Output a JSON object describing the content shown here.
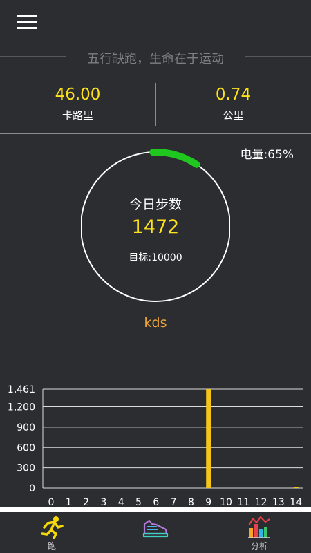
{
  "header": {
    "menu_icon": "hamburger-menu-icon"
  },
  "slogan": "五行缺跑，生命在于运动",
  "stats": {
    "calories": {
      "value": "46.00",
      "label": "卡路里"
    },
    "distance": {
      "value": "0.74",
      "label": "公里"
    }
  },
  "battery": "电量:65%",
  "ring": {
    "title": "今日步数",
    "steps": "1472",
    "goal": "目标:10000",
    "progress": 0.1472,
    "progress_color": "#1fc71f"
  },
  "device_name": "kds",
  "chart_data": {
    "type": "bar",
    "categories": [
      "0",
      "1",
      "2",
      "3",
      "4",
      "5",
      "6",
      "7",
      "8",
      "9",
      "10",
      "11",
      "12",
      "13",
      "14"
    ],
    "values": [
      0,
      0,
      0,
      0,
      0,
      0,
      0,
      0,
      0,
      1461,
      0,
      0,
      0,
      0,
      15
    ],
    "y_ticks": [
      "0",
      "300",
      "600",
      "900",
      "1,200",
      "1,461"
    ],
    "ylim": [
      0,
      1461
    ],
    "bar_color": "#f5c518",
    "grid": true
  },
  "tabs": [
    {
      "label": "跑",
      "icon": "running-person-icon"
    },
    {
      "label": "",
      "icon": "sneaker-icon"
    },
    {
      "label": "分析",
      "icon": "analysis-chart-icon"
    }
  ]
}
